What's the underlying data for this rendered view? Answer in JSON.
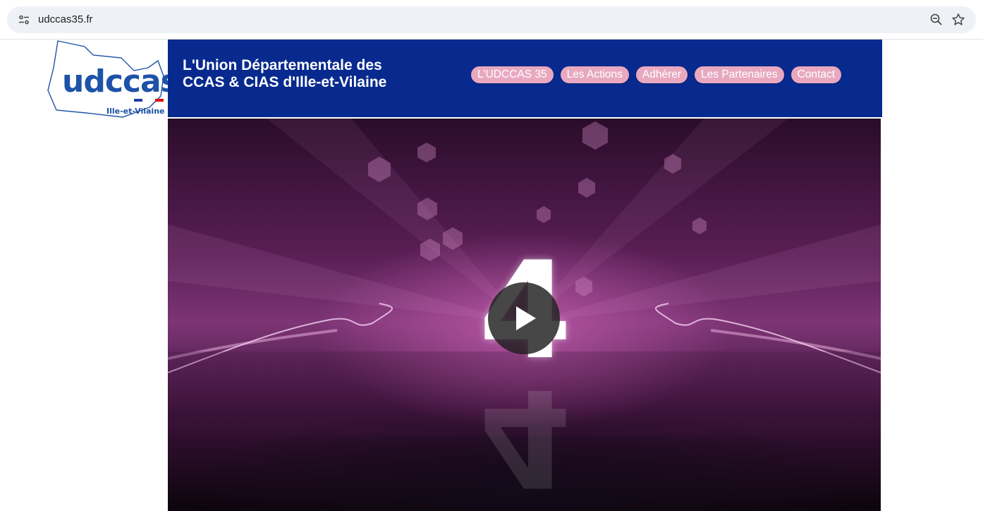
{
  "browser": {
    "url": "udccas35.fr",
    "icons": [
      "site-info-icon",
      "zoom-icon",
      "bookmark-star-icon"
    ]
  },
  "logo": {
    "word": "udccas",
    "subtitle": "Ille-et-Vilaine",
    "flag_colors": [
      "#1d3fa6",
      "#ffffff",
      "#e1000f"
    ]
  },
  "header": {
    "title_line1": "L'Union Départementale des",
    "title_line2": "CCAS & CIAS d'Ille-et-Vilaine",
    "background": "#082a8e"
  },
  "nav": {
    "items": [
      {
        "label": "L'UDCCAS 35"
      },
      {
        "label": "Les Actions"
      },
      {
        "label": "Adhérer"
      },
      {
        "label": "Les Partenaires"
      },
      {
        "label": "Contact"
      }
    ],
    "button_color": "#e8a9c0"
  },
  "video": {
    "frame_text": "4",
    "controls": [
      "play-icon"
    ]
  }
}
